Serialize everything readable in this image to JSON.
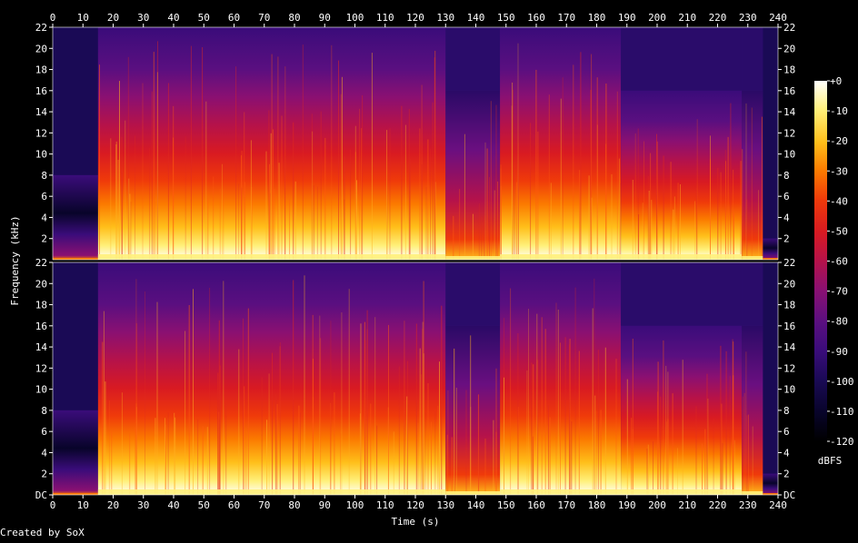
{
  "chart_data": {
    "type": "heatmap",
    "subtype": "spectrogram",
    "xlabel": "Time (s)",
    "ylabel": "Frequency (kHz)",
    "credit": "Created by SoX",
    "x_ticks": [
      "0",
      "10",
      "20",
      "30",
      "40",
      "50",
      "60",
      "70",
      "80",
      "90",
      "100",
      "110",
      "120",
      "130",
      "140",
      "150",
      "160",
      "170",
      "180",
      "190",
      "200",
      "210",
      "220",
      "230",
      "240"
    ],
    "xlim": [
      0,
      240
    ],
    "ylim_khz": [
      0,
      22
    ],
    "y_ticks_upper": [
      "22",
      "20",
      "18",
      "16",
      "14",
      "12",
      "10",
      "8",
      "6",
      "4",
      "2"
    ],
    "y_ticks_lower": [
      "22",
      "20",
      "18",
      "16",
      "14",
      "12",
      "10",
      "8",
      "6",
      "4",
      "2",
      "DC"
    ],
    "channels": 2,
    "colorbar": {
      "unit_label": "dBFS",
      "ticks": [
        "+0",
        "-10",
        "-20",
        "-30",
        "-40",
        "-50",
        "-60",
        "-70",
        "-80",
        "-90",
        "-100",
        "-110",
        "-120"
      ],
      "range_db": [
        -120,
        0
      ],
      "colors": [
        "#000000",
        "#08042a",
        "#1a0a55",
        "#3a0c7a",
        "#5a0f80",
        "#8a1072",
        "#b5124a",
        "#d81a22",
        "#ef3a0a",
        "#fb7a00",
        "#ffbf1a",
        "#fff07a",
        "#ffffff"
      ]
    },
    "segments": [
      {
        "start": 0,
        "end": 15,
        "level": "quiet",
        "upper_extent_khz": 8
      },
      {
        "start": 15,
        "end": 130,
        "level": "loud",
        "upper_extent_khz": 22
      },
      {
        "start": 130,
        "end": 148,
        "level": "moderate",
        "upper_extent_khz": 16
      },
      {
        "start": 148,
        "end": 188,
        "level": "loud",
        "upper_extent_khz": 22
      },
      {
        "start": 188,
        "end": 228,
        "level": "loud",
        "upper_extent_khz": 16
      },
      {
        "start": 228,
        "end": 235,
        "level": "moderate",
        "upper_extent_khz": 16
      },
      {
        "start": 235,
        "end": 240,
        "level": "quiet",
        "upper_extent_khz": 2
      }
    ]
  }
}
